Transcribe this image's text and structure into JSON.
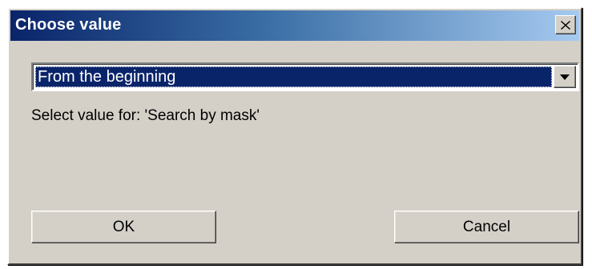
{
  "dialog": {
    "title": "Choose value",
    "close_icon": "close-icon"
  },
  "select": {
    "value": "From the beginning",
    "arrow_icon": "chevron-down-icon"
  },
  "prompt": "Select value for: 'Search by mask'",
  "buttons": {
    "ok_label": "OK",
    "cancel_label": "Cancel"
  },
  "colors": {
    "titlebar_start": "#0a246a",
    "titlebar_end": "#a6caf0",
    "face": "#d4d0c8",
    "selection": "#0a246a"
  }
}
